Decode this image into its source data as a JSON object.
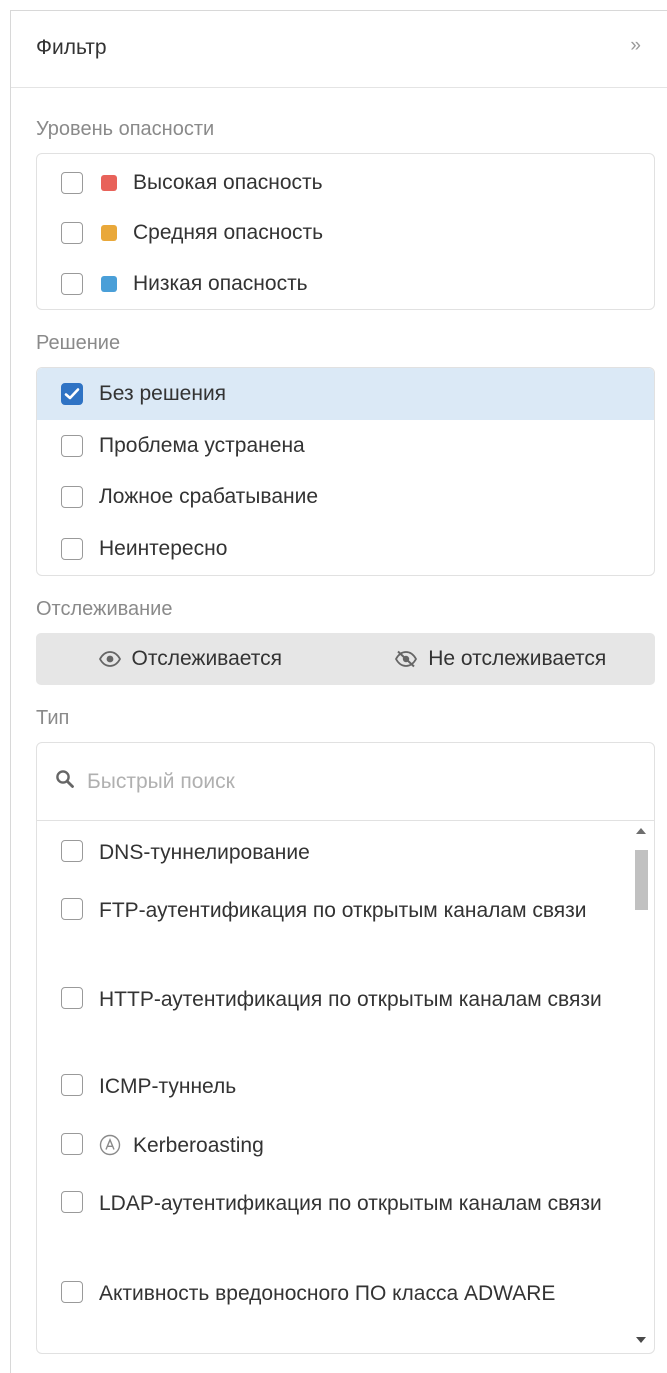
{
  "header": {
    "title": "Фильтр",
    "collapse_icon": "»"
  },
  "severity": {
    "label": "Уровень опасности",
    "items": [
      {
        "label": "Высокая опасность",
        "color": "#e8625a",
        "checked": false
      },
      {
        "label": "Средняя опасность",
        "color": "#e9a83a",
        "checked": false
      },
      {
        "label": "Низкая опасность",
        "color": "#4a9fd8",
        "checked": false
      }
    ]
  },
  "resolution": {
    "label": "Решение",
    "items": [
      {
        "label": "Без решения",
        "checked": true
      },
      {
        "label": "Проблема устранена",
        "checked": false
      },
      {
        "label": "Ложное срабатывание",
        "checked": false
      },
      {
        "label": "Неинтересно",
        "checked": false
      }
    ]
  },
  "tracking": {
    "label": "Отслеживание",
    "options": [
      {
        "label": "Отслеживается",
        "icon": "eye-icon"
      },
      {
        "label": "Не отслеживается",
        "icon": "eye-slash-icon"
      }
    ]
  },
  "type": {
    "label": "Тип",
    "search_placeholder": "Быстрый поиск",
    "items": [
      {
        "label": "DNS-туннелирование",
        "checked": false
      },
      {
        "label": "FTP-аутентификация по открытым каналам связи",
        "checked": false
      },
      {
        "label": "HTTP-аутентификация по открытым каналам связи",
        "checked": false
      },
      {
        "label": "ICMP-туннель",
        "checked": false
      },
      {
        "label": "Kerberoasting",
        "checked": false,
        "icon": "circled-a-icon"
      },
      {
        "label": "LDAP-аутентификация по открытым каналам связи",
        "checked": false
      },
      {
        "label": "Активность вредоносного ПО класса ADWARE",
        "checked": false
      }
    ]
  },
  "colors": {
    "accent": "#2f73c4",
    "selected_row": "#dbe9f6"
  }
}
